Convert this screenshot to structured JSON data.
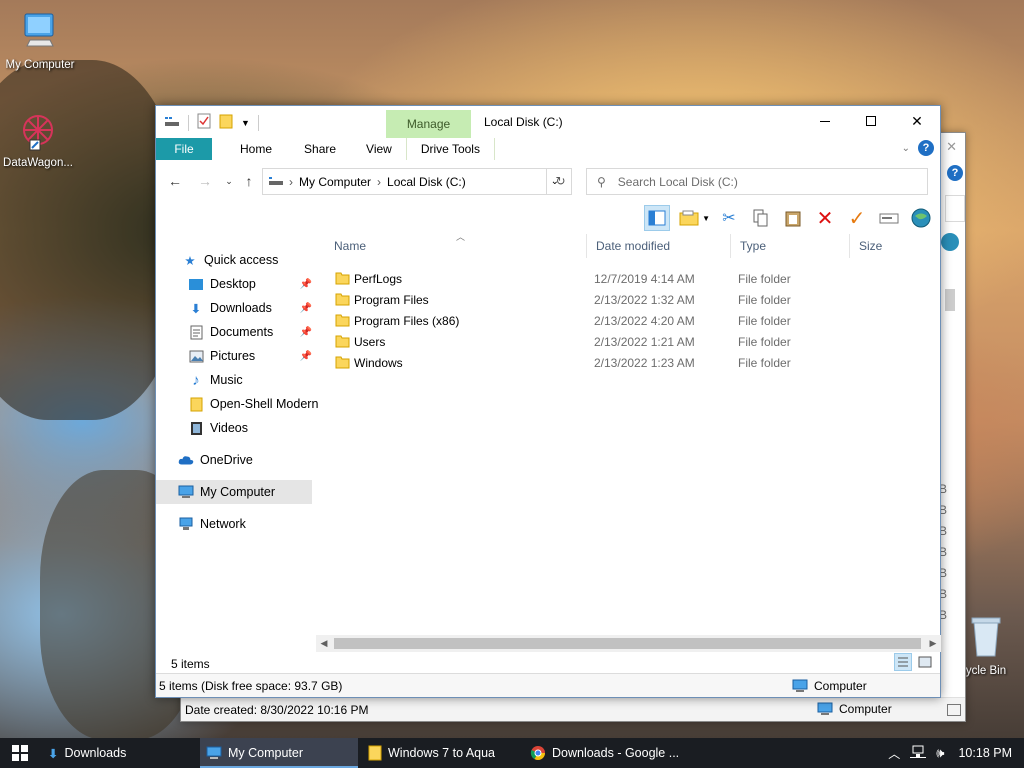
{
  "desktop": {
    "icons": [
      {
        "label": "My Computer"
      },
      {
        "label": "DataWagon..."
      },
      {
        "label": "ycle Bin"
      }
    ]
  },
  "window": {
    "title": "Local Disk (C:)",
    "contextual_tab_group": "Manage",
    "ribbon_tabs": [
      "File",
      "Home",
      "Share",
      "View",
      "Drive Tools"
    ],
    "address_path": [
      "My Computer",
      "Local Disk (C:)"
    ],
    "search_placeholder": "Search Local Disk (C:)",
    "nav_pane": {
      "quick_access": "Quick access",
      "quick_items": [
        "Desktop",
        "Downloads",
        "Documents",
        "Pictures",
        "Music",
        "Open-Shell Modern",
        "Videos"
      ],
      "onedrive": "OneDrive",
      "my_computer": "My Computer",
      "network": "Network"
    },
    "columns": [
      "Name",
      "Date modified",
      "Type",
      "Size"
    ],
    "files": [
      {
        "name": "PerfLogs",
        "date": "12/7/2019 4:14 AM",
        "type": "File folder"
      },
      {
        "name": "Program Files",
        "date": "2/13/2022 1:32 AM",
        "type": "File folder"
      },
      {
        "name": "Program Files (x86)",
        "date": "2/13/2022 4:20 AM",
        "type": "File folder"
      },
      {
        "name": "Users",
        "date": "2/13/2022 1:21 AM",
        "type": "File folder"
      },
      {
        "name": "Windows",
        "date": "2/13/2022 1:23 AM",
        "type": "File folder"
      }
    ],
    "item_count": "5 items",
    "status_left": "5 items (Disk free space: 93.7 GB)",
    "status_right": "Computer"
  },
  "back_window": {
    "status_left": "Date created: 8/30/2022 10:16 PM",
    "status_right": "Computer",
    "size_fragments": [
      "B",
      "B",
      "B",
      "B",
      "B",
      "B",
      "B"
    ]
  },
  "taskbar": {
    "items": [
      "Downloads",
      "My Computer",
      "Windows 7 to Aqua",
      "Downloads - Google ..."
    ],
    "clock": "10:18 PM"
  },
  "colors": {
    "file_tab": "#1c9aa8",
    "manage_tab": "#c6ecb3",
    "taskbar": "#1a1d22",
    "selection": "#cde6f7"
  }
}
